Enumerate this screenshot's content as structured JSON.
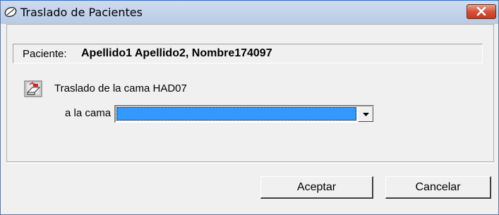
{
  "window": {
    "title": "Traslado de Pacientes",
    "title_icon": "capsule-icon",
    "close_icon": "close-icon"
  },
  "patient": {
    "label": "Paciente:",
    "value": "Apellido1 Apellido2, Nombre174097"
  },
  "transfer": {
    "icon": "bed-transfer-icon",
    "text": "Traslado de la cama HAD07",
    "to_label": "a la cama",
    "bed_select_value": "",
    "dropdown_icon": "chevron-down-icon"
  },
  "buttons": {
    "accept": "Aceptar",
    "cancel": "Cancelar"
  },
  "colors": {
    "title_bar": "#c3d3ea",
    "close_button": "#d3533a",
    "selection": "#3399ff",
    "dialog_bg": "#f0f0f0"
  }
}
